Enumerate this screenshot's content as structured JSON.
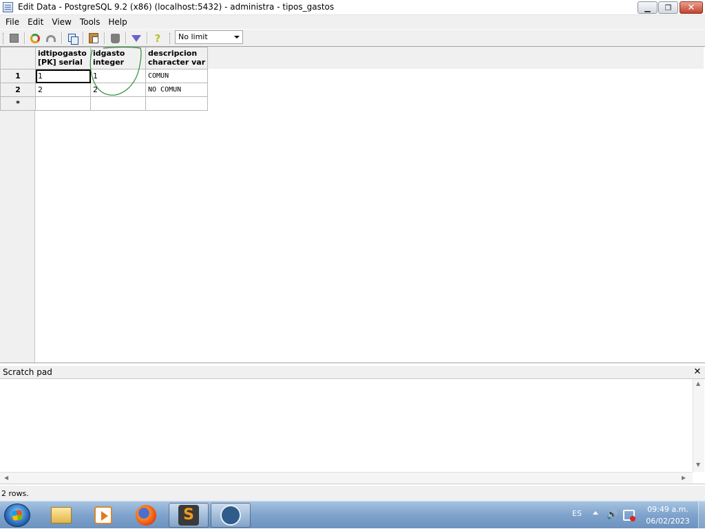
{
  "window": {
    "title": "Edit Data - PostgreSQL 9.2 (x86) (localhost:5432) - administra - tipos_gastos",
    "minimize_glyph": "▁",
    "maximize_glyph": "❐",
    "close_glyph": "✕"
  },
  "menu": [
    {
      "label": "File"
    },
    {
      "label": "Edit"
    },
    {
      "label": "View"
    },
    {
      "label": "Tools"
    },
    {
      "label": "Help"
    }
  ],
  "toolbar": {
    "buttons": [
      "stop-icon",
      "refresh-icon",
      "undo-icon",
      "copy-icon",
      "paste-icon",
      "delete-icon",
      "filter-icon",
      "help-icon"
    ],
    "help_glyph": "?",
    "limit_value": "No limit"
  },
  "grid": {
    "columns": [
      {
        "name": "idtipogasto",
        "type": "[PK] serial"
      },
      {
        "name": "idgasto",
        "type": "integer"
      },
      {
        "name": "descripcion",
        "type": "character var"
      }
    ],
    "rows": [
      {
        "row_label": "1",
        "cells": [
          "1",
          "1",
          "COMUN"
        ]
      },
      {
        "row_label": "2",
        "cells": [
          "2",
          "2",
          "NO  COMUN"
        ]
      }
    ],
    "new_row_label": "*"
  },
  "scratch_pad": {
    "title": "Scratch pad",
    "close_glyph": "✕",
    "scroll_up": "▲",
    "scroll_down": "▼",
    "scroll_left": "◀",
    "scroll_right": "▶"
  },
  "status": {
    "text": "2 rows."
  },
  "taskbar": {
    "apps": [
      "folder-icon",
      "media-player-icon",
      "firefox-icon",
      "sublime-text-icon",
      "pgadmin-icon"
    ],
    "sublime_glyph": "S",
    "language": "ES",
    "speaker_glyph": "🔊",
    "time": "09:49 a.m.",
    "date": "06/02/2023"
  },
  "colors": {
    "annotation_stroke": "#2e8b3a",
    "selection_border": "#000000"
  }
}
